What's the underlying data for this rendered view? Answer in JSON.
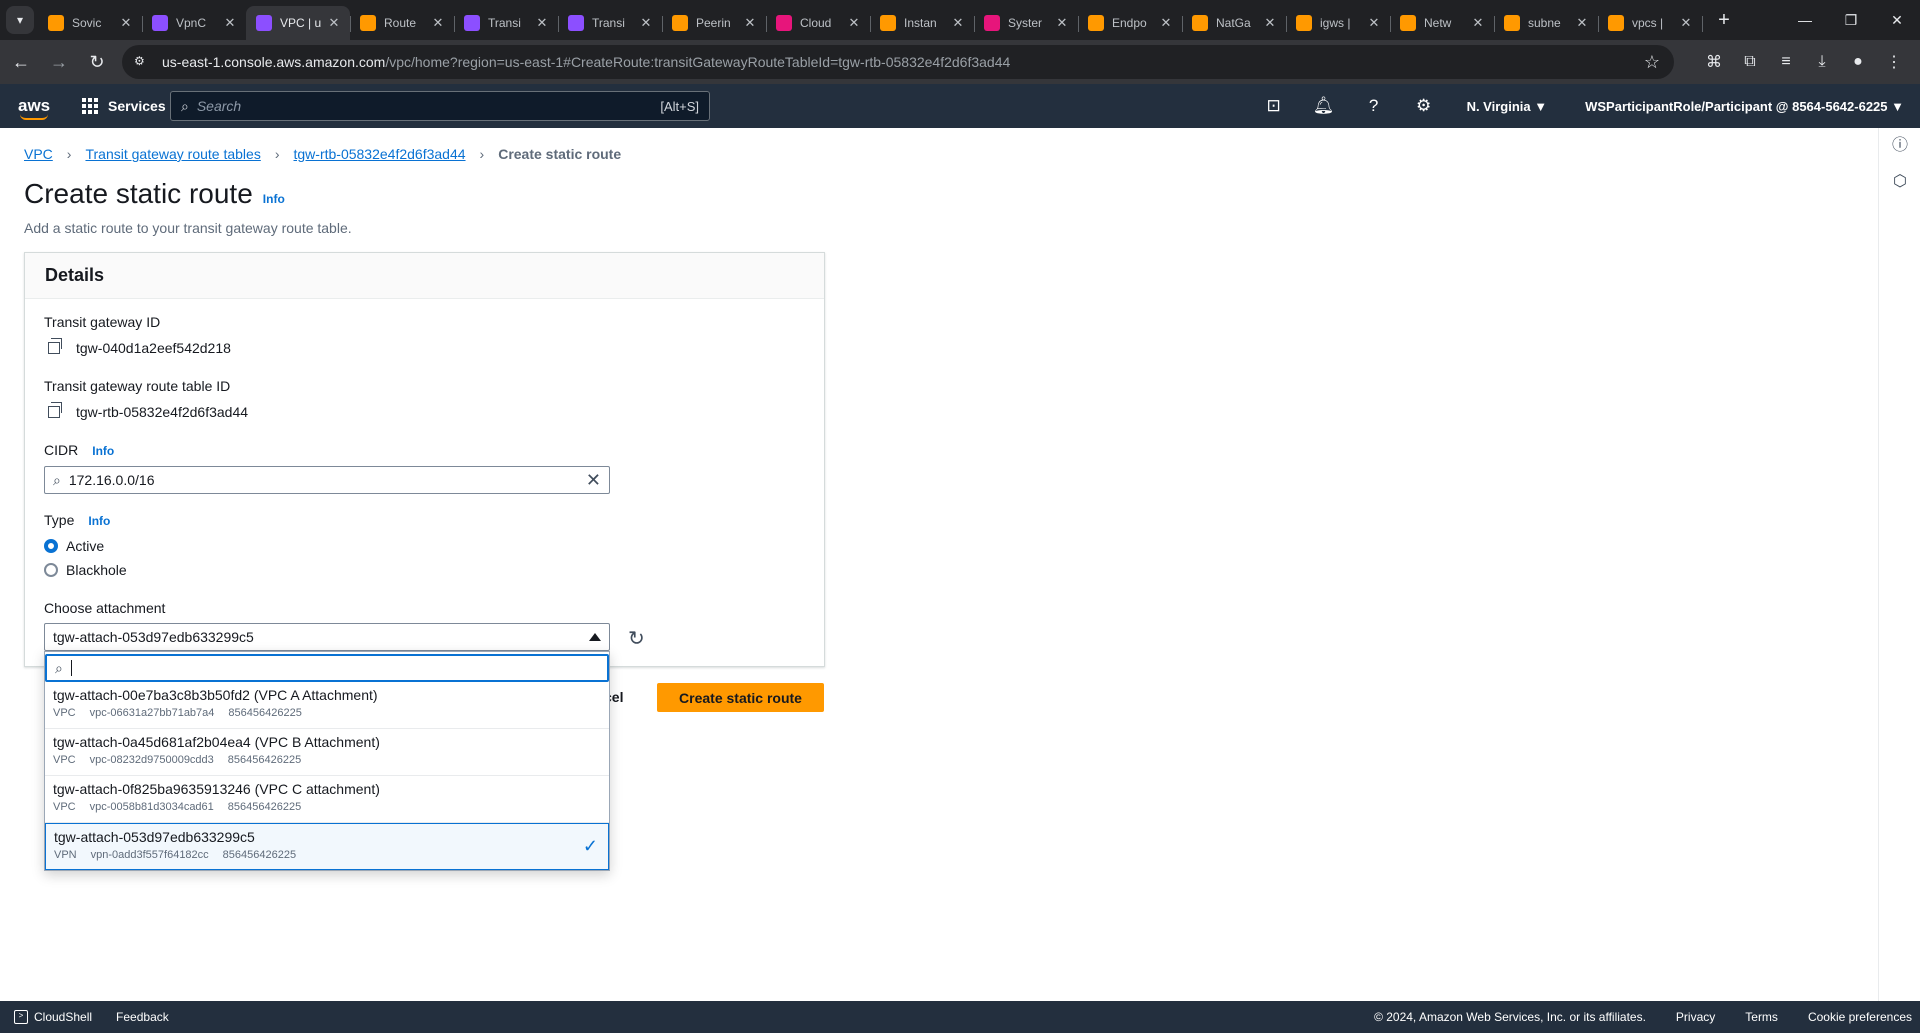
{
  "browser": {
    "tabs": [
      {
        "title": "Sovic",
        "color": "#ff9900"
      },
      {
        "title": "VpnC",
        "color": "#8c4fff"
      },
      {
        "title": "VPC | u",
        "color": "#8c4fff",
        "active": true
      },
      {
        "title": "Route",
        "color": "#ff9900"
      },
      {
        "title": "Transi",
        "color": "#8c4fff"
      },
      {
        "title": "Transi",
        "color": "#8c4fff"
      },
      {
        "title": "Peerin",
        "color": "#ff9900"
      },
      {
        "title": "Cloud",
        "color": "#e7157b"
      },
      {
        "title": "Instan",
        "color": "#ff9900"
      },
      {
        "title": "Syster",
        "color": "#e7157b"
      },
      {
        "title": "Endpo",
        "color": "#ff9900"
      },
      {
        "title": "NatGa",
        "color": "#ff9900"
      },
      {
        "title": "igws |",
        "color": "#ff9900"
      },
      {
        "title": "Netw",
        "color": "#ff9900"
      },
      {
        "title": "subne",
        "color": "#ff9900"
      },
      {
        "title": "vpcs |",
        "color": "#ff9900"
      }
    ],
    "url_host": "us-east-1.console.aws.amazon.com",
    "url_path": "/vpc/home?region=us-east-1#CreateRoute:transitGatewayRouteTableId=tgw-rtb-05832e4f2d6f3ad44"
  },
  "header": {
    "logo": "aws",
    "services": "Services",
    "search_placeholder": "Search",
    "search_shortcut": "[Alt+S]",
    "region": "N. Virginia ▼",
    "account": "WSParticipantRole/Participant @ 8564-5642-6225 ▼"
  },
  "breadcrumb": {
    "vpc": "VPC",
    "route_tables": "Transit gateway route tables",
    "rtb": "tgw-rtb-05832e4f2d6f3ad44",
    "current": "Create static route"
  },
  "page": {
    "title": "Create static route",
    "info": "Info",
    "description": "Add a static route to your transit gateway route table."
  },
  "details": {
    "heading": "Details",
    "tgw_label": "Transit gateway ID",
    "tgw_value": "tgw-040d1a2eef542d218",
    "rtb_label": "Transit gateway route table ID",
    "rtb_value": "tgw-rtb-05832e4f2d6f3ad44",
    "cidr_label": "CIDR",
    "cidr_value": "172.16.0.0/16",
    "type_label": "Type",
    "type_active": "Active",
    "type_blackhole": "Blackhole",
    "attach_label": "Choose attachment",
    "attach_value": "tgw-attach-053d97edb633299c5"
  },
  "dropdown": {
    "items": [
      {
        "main": "tgw-attach-00e7ba3c8b3b50fd2 (VPC A Attachment)",
        "kind": "VPC",
        "res": "vpc-06631a27bb71ab7a4",
        "acct": "856456426225"
      },
      {
        "main": "tgw-attach-0a45d681af2b04ea4 (VPC B Attachment)",
        "kind": "VPC",
        "res": "vpc-08232d9750009cdd3",
        "acct": "856456426225"
      },
      {
        "main": "tgw-attach-0f825ba9635913246 (VPC C attachment)",
        "kind": "VPC",
        "res": "vpc-0058b81d3034cad61",
        "acct": "856456426225"
      },
      {
        "main": "tgw-attach-053d97edb633299c5",
        "kind": "VPN",
        "res": "vpn-0add3f557f64182cc",
        "acct": "856456426225"
      }
    ]
  },
  "actions": {
    "cancel_fragment": "cel",
    "submit": "Create static route"
  },
  "footer": {
    "cloudshell": "CloudShell",
    "feedback": "Feedback",
    "copyright": "© 2024, Amazon Web Services, Inc. or its affiliates.",
    "privacy": "Privacy",
    "terms": "Terms",
    "cookies": "Cookie preferences"
  }
}
